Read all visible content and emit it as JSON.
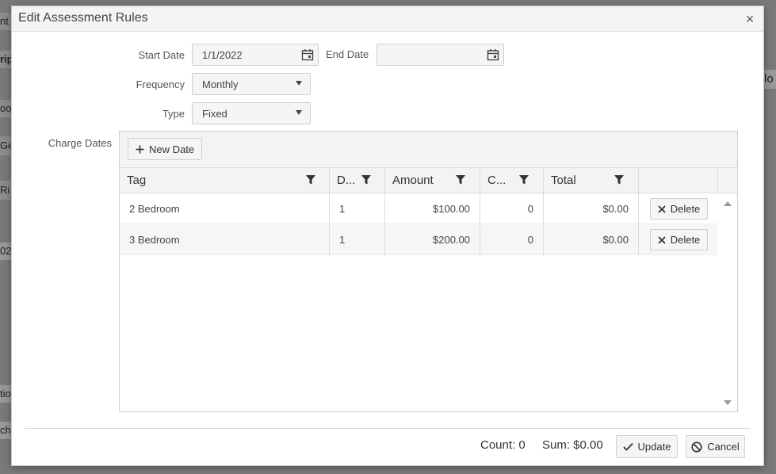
{
  "dialog": {
    "title": "Edit Assessment Rules",
    "close_icon": "close-icon"
  },
  "form": {
    "start_date_label": "Start Date",
    "start_date_value": "1/1/2022",
    "end_date_label": "End Date",
    "end_date_value": "",
    "frequency_label": "Frequency",
    "frequency_value": "Monthly",
    "type_label": "Type",
    "type_value": "Fixed",
    "charge_dates_label": "Charge Dates"
  },
  "grid": {
    "new_date_label": "New Date",
    "columns": [
      "Tag",
      "D...",
      "Amount",
      "C...",
      "Total",
      ""
    ],
    "rows": [
      {
        "tag": "2 Bedroom",
        "d": "1",
        "amount": "$100.00",
        "c": "0",
        "total": "$0.00",
        "action": "Delete"
      },
      {
        "tag": "3 Bedroom",
        "d": "1",
        "amount": "$200.00",
        "c": "0",
        "total": "$0.00",
        "action": "Delete"
      }
    ]
  },
  "footer": {
    "count": "Count: 0",
    "sum": "Sum: $0.00",
    "update_label": "Update",
    "cancel_label": "Cancel"
  },
  "background": {
    "frag1": "nt",
    "frag2": "rip",
    "frag3": "lo",
    "frag4": "oo",
    "frag5": "Ge",
    "frag6": "Ri",
    "frag7": "02",
    "frag8": "tio",
    "frag9": "cha"
  },
  "colors": {
    "accent": "#333333",
    "panel": "#f3f3f3"
  }
}
